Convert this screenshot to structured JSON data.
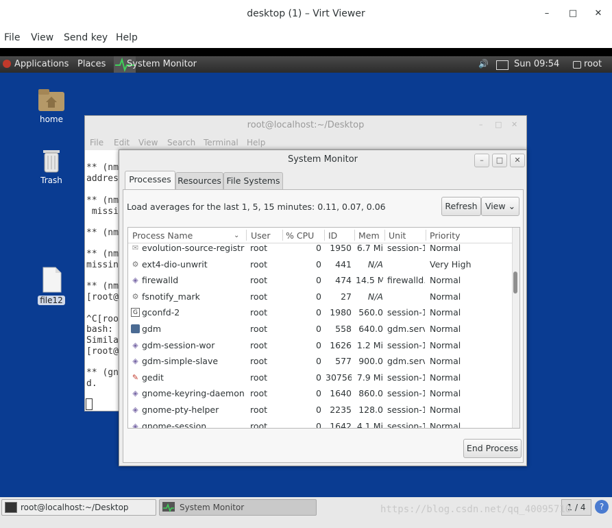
{
  "viewer": {
    "title": "desktop (1) – Virt Viewer",
    "window_buttons": {
      "minimize": "–",
      "maximize": "□",
      "close": "✕"
    },
    "menu": [
      "File",
      "View",
      "Send key",
      "Help"
    ]
  },
  "guest_panel": {
    "applications": "Applications",
    "places": "Places",
    "active_app": "System Monitor",
    "time": "Sun 09:54",
    "user": "root"
  },
  "desktop_icons": [
    {
      "label": "home",
      "icon": "folder-icon"
    },
    {
      "label": "Trash",
      "icon": "trash-icon"
    },
    {
      "label": "file12",
      "icon": "file-icon"
    }
  ],
  "terminal": {
    "title": "root@localhost:~/Desktop",
    "menu": [
      "File",
      "Edit",
      "View",
      "Search",
      "Terminal",
      "Help"
    ],
    "lines": [
      "** (nm",
      "addres",
      "",
      "** (nm",
      " missi",
      "",
      "** (nm",
      "",
      "** (nm",
      "missin",
      "",
      "** (nm",
      "[root@",
      "",
      "^C[roo",
      "bash:",
      "Simila",
      "[root@",
      "",
      "** (gn",
      "d."
    ]
  },
  "sysmon": {
    "title": "System Monitor",
    "tabs": [
      "Processes",
      "Resources",
      "File Systems"
    ],
    "active_tab": "Processes",
    "load_averages": "Load averages for the last 1, 5, 15 minutes: 0.11, 0.07, 0.06",
    "refresh_label": "Refresh",
    "view_label": "View",
    "end_process_label": "End Process",
    "columns": [
      "Process Name",
      "User",
      "% CPU",
      "ID",
      "Mem",
      "Unit",
      "Priority"
    ],
    "rows": [
      {
        "name": "evolution-source-registry",
        "user": "root",
        "cpu": "0",
        "id": "1950",
        "mem": "6.7 Mi",
        "unit": "session-1",
        "priority": "Normal",
        "icon": "application-icon"
      },
      {
        "name": "ext4-dio-unwrit",
        "user": "root",
        "cpu": "0",
        "id": "441",
        "mem": "N/A",
        "unit": "",
        "priority": "Very High",
        "icon": "gear-icon"
      },
      {
        "name": "firewalld",
        "user": "root",
        "cpu": "0",
        "id": "474",
        "mem": "14.5 M",
        "unit": "firewalld.",
        "priority": "Normal",
        "icon": "diamond-icon"
      },
      {
        "name": "fsnotify_mark",
        "user": "root",
        "cpu": "0",
        "id": "27",
        "mem": "N/A",
        "unit": "",
        "priority": "Normal",
        "icon": "gear-icon"
      },
      {
        "name": "gconfd-2",
        "user": "root",
        "cpu": "0",
        "id": "1980",
        "mem": "560.0",
        "unit": "session-1",
        "priority": "Normal",
        "icon": "gconf-icon"
      },
      {
        "name": "gdm",
        "user": "root",
        "cpu": "0",
        "id": "558",
        "mem": "640.0",
        "unit": "gdm.servi",
        "priority": "Normal",
        "icon": "monitor-icon"
      },
      {
        "name": "gdm-session-wor",
        "user": "root",
        "cpu": "0",
        "id": "1626",
        "mem": "1.2 Mi",
        "unit": "session-1",
        "priority": "Normal",
        "icon": "diamond-icon"
      },
      {
        "name": "gdm-simple-slave",
        "user": "root",
        "cpu": "0",
        "id": "577",
        "mem": "900.0",
        "unit": "gdm.servi",
        "priority": "Normal",
        "icon": "diamond-icon"
      },
      {
        "name": "gedit",
        "user": "root",
        "cpu": "0",
        "id": "30756",
        "mem": "7.9 Mi",
        "unit": "session-1",
        "priority": "Normal",
        "icon": "text-editor-icon"
      },
      {
        "name": "gnome-keyring-daemon",
        "user": "root",
        "cpu": "0",
        "id": "1640",
        "mem": "860.0",
        "unit": "session-1",
        "priority": "Normal",
        "icon": "diamond-icon"
      },
      {
        "name": "gnome-pty-helper",
        "user": "root",
        "cpu": "0",
        "id": "2235",
        "mem": "128.0",
        "unit": "session-1",
        "priority": "Normal",
        "icon": "diamond-icon"
      },
      {
        "name": "gnome-session",
        "user": "root",
        "cpu": "0",
        "id": "1642",
        "mem": "4.1 Mi",
        "unit": "session-1",
        "priority": "Normal",
        "icon": "diamond-icon"
      }
    ]
  },
  "taskbar": {
    "items": [
      "root@localhost:~/Desktop",
      "System Monitor"
    ],
    "workspace": "1 / 4",
    "help": "?",
    "watermark": "https://blog.csdn.net/qq_40095710"
  }
}
